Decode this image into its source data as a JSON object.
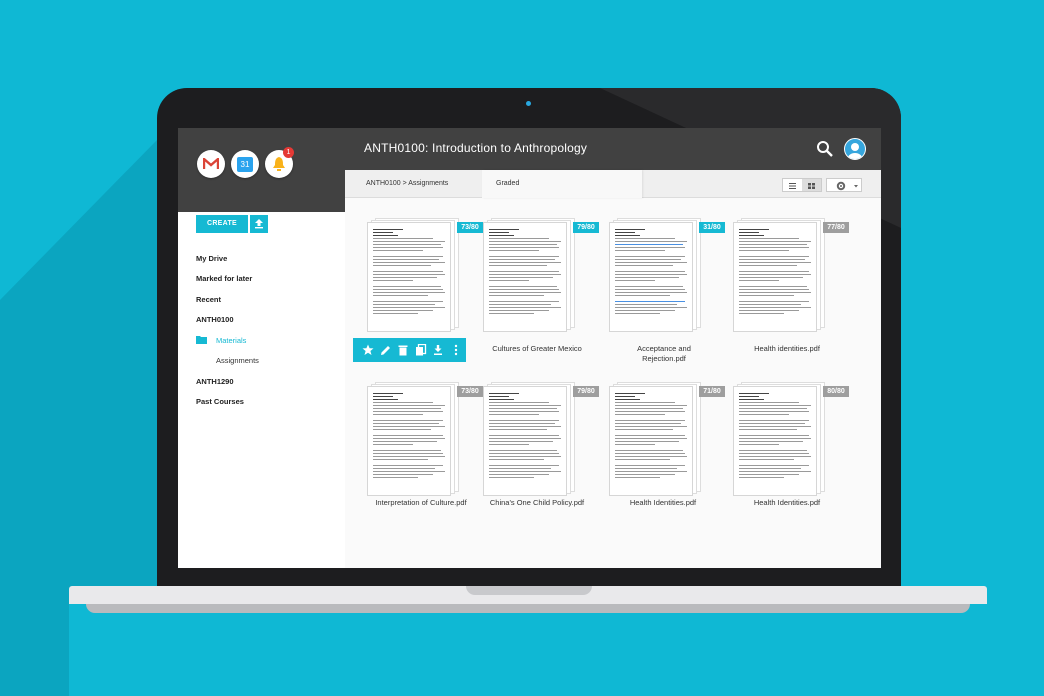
{
  "app": {
    "course_title": "ANTH0100: Introduction to Anthropology",
    "apps": [
      {
        "name": "gmail-icon",
        "badge": ""
      },
      {
        "name": "calendar-icon",
        "label": "31"
      },
      {
        "name": "notifications-icon",
        "badge": "1"
      }
    ]
  },
  "sidebar": {
    "create_label": "CREATE",
    "items": {
      "my_drive": "My Drive",
      "marked_later": "Marked for later",
      "recent": "Recent",
      "anth0100": "ANTH0100",
      "materials": "Materials",
      "assignments": "Assignments",
      "anth1290": "ANTH1290",
      "past_courses": "Past Courses"
    }
  },
  "toolbar": {
    "breadcrumb": "ANTH0100 > Assignments",
    "tab": "Graded"
  },
  "files": [
    {
      "name": "",
      "grade": "73/80",
      "highlight": true
    },
    {
      "name": "Cultures of Greater Mexico",
      "grade": "79/80",
      "highlight": true
    },
    {
      "name": "Acceptance and Rejection.pdf",
      "grade": "31/80",
      "highlight": true
    },
    {
      "name": "Health identities.pdf",
      "grade": "77/80",
      "highlight": false
    },
    {
      "name": "Interpretation of Culture.pdf",
      "grade": "73/80",
      "highlight": false
    },
    {
      "name": "China's One Child Policy.pdf",
      "grade": "79/80",
      "highlight": false
    },
    {
      "name": "Health Identities.pdf",
      "grade": "71/80",
      "highlight": false
    },
    {
      "name": "Health Identities.pdf",
      "grade": "80/80",
      "highlight": false
    }
  ],
  "colors": {
    "accent": "#16b9d3",
    "background": "#0fb8d4",
    "topbar": "#414141",
    "grade_inactive": "#9e9e9e"
  }
}
